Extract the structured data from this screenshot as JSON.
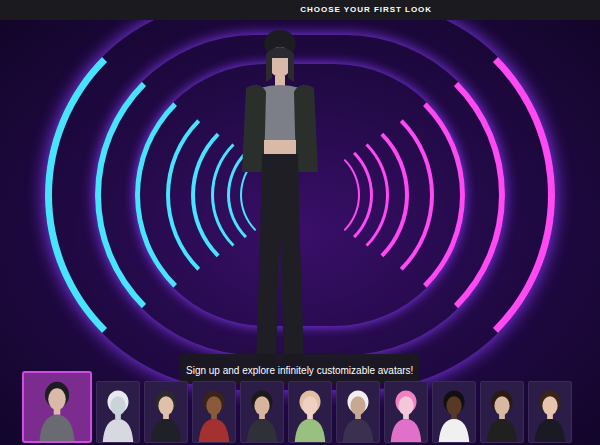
{
  "header": {
    "title": "CHOOSE YOUR FIRST LOOK"
  },
  "tooltip": "Sign up and explore infinitely customizable avatars!",
  "avatars": [
    {
      "selected": true
    },
    {
      "selected": false
    },
    {
      "selected": false
    },
    {
      "selected": false
    },
    {
      "selected": false
    },
    {
      "selected": false
    },
    {
      "selected": false
    },
    {
      "selected": false
    },
    {
      "selected": false
    },
    {
      "selected": false
    },
    {
      "selected": false
    }
  ]
}
